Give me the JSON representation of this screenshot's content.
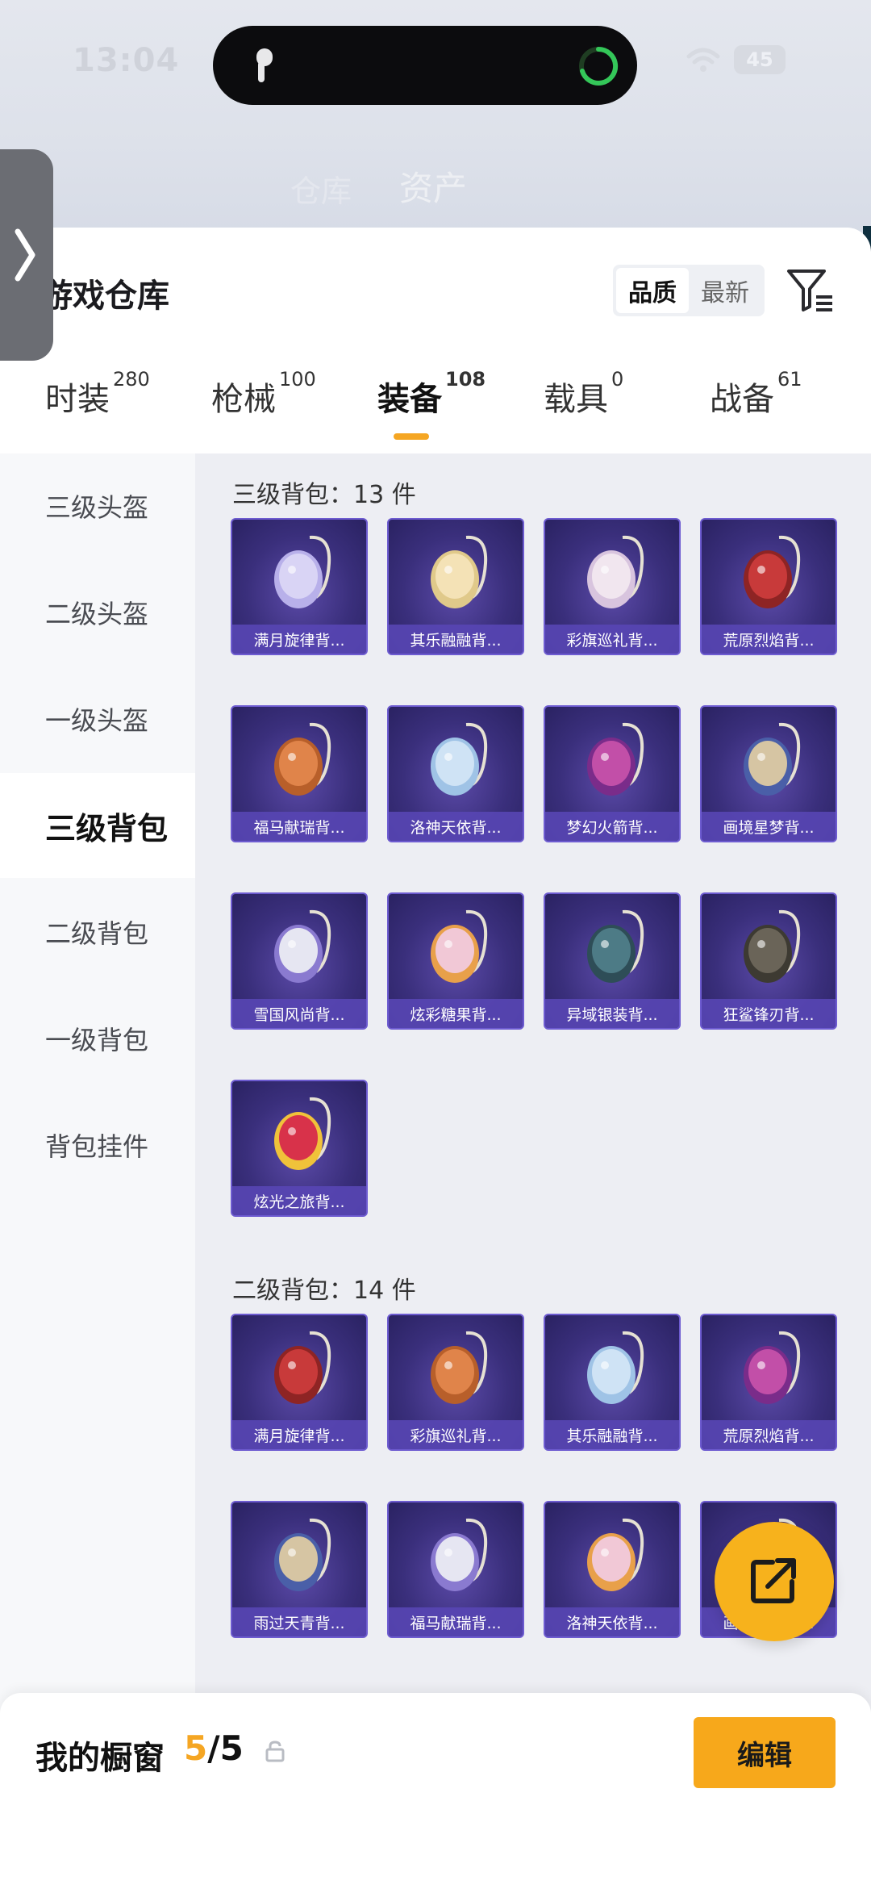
{
  "status_bar": {
    "time": "13:04",
    "battery": "45"
  },
  "background": {
    "title": "资产",
    "left_text": "仓库"
  },
  "panel": {
    "title": "游戏仓库",
    "sort_options": [
      "品质",
      "最新"
    ],
    "tabs": [
      {
        "label": "时装",
        "count": "280"
      },
      {
        "label": "枪械",
        "count": "100"
      },
      {
        "label": "装备",
        "count": "108"
      },
      {
        "label": "载具",
        "count": "0"
      },
      {
        "label": "战备",
        "count": "61"
      }
    ],
    "active_tab": "装备"
  },
  "categories": [
    "三级头盔",
    "二级头盔",
    "一级头盔",
    "三级背包",
    "二级背包",
    "一级背包",
    "背包挂件"
  ],
  "active_category": "三级背包",
  "sections": [
    {
      "heading": "三级背包：13 件",
      "items": [
        "满月旋律背...",
        "其乐融融背...",
        "彩旗巡礼背...",
        "荒原烈焰背...",
        "福马献瑞背...",
        "洛神天依背...",
        "梦幻火箭背...",
        "画境星梦背...",
        "雪国风尚背...",
        "炫彩糖果背...",
        "异域银装背...",
        "狂鲨锋刃背...",
        "炫光之旅背..."
      ]
    },
    {
      "heading": "二级背包：14 件",
      "items": [
        "满月旋律背...",
        "彩旗巡礼背...",
        "其乐融融背...",
        "荒原烈焰背...",
        "雨过天青背...",
        "福马献瑞背...",
        "洛神天依背...",
        "画境星梦背..."
      ]
    }
  ],
  "bottom_bar": {
    "title": "我的橱窗",
    "current": "5",
    "max": "/5",
    "edit_label": "编辑"
  },
  "colors": {
    "accent": "#f5a623",
    "card_bg": "#3a2f7c",
    "card_label": "#5846b4"
  },
  "icons": {
    "handle": "chevron-right-icon",
    "filter": "filter-icon",
    "fab": "share-icon",
    "lock": "lock-icon"
  }
}
